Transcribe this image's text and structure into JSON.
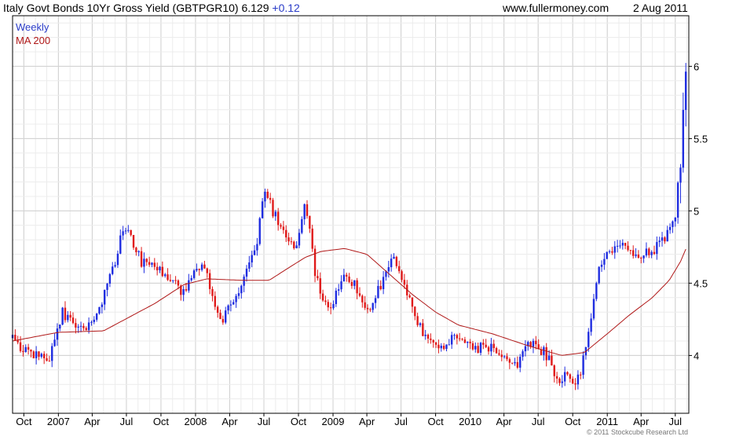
{
  "header": {
    "title": "Italy Govt Bonds 10Yr Gross Yield (GBTPGR10)",
    "last": "6.129",
    "change": "+0.12",
    "site": "www.fullermoney.com",
    "date": "2 Aug 2011"
  },
  "legend": {
    "primary": "Weekly",
    "secondary": "MA 200"
  },
  "copyright": "© 2011 Stockcube Research Ltd",
  "colors": {
    "up": "#1f2de0",
    "down": "#e01a1a",
    "ma": "#b01818",
    "grid": "#d0d0d0",
    "legend_primary": "#2a3cc8",
    "legend_secondary": "#b01818"
  },
  "chart_data": {
    "type": "candlestick",
    "frequency": "weekly",
    "x_ticks": [
      "Oct",
      "2007",
      "Apr",
      "Jul",
      "Oct",
      "2008",
      "Apr",
      "Jul",
      "Oct",
      "2009",
      "Apr",
      "Jul",
      "Oct",
      "2010",
      "Apr",
      "Jul",
      "Oct",
      "2011",
      "Apr",
      "Jul"
    ],
    "y_ticks": [
      "4",
      "4.5",
      "5",
      "5.5",
      "6"
    ],
    "ylim": [
      3.6,
      6.35
    ],
    "grid": true,
    "legend_position": "top-left",
    "price_path": [
      [
        "2006-09-01",
        4.12
      ],
      [
        "2006-10-15",
        4.0
      ],
      [
        "2006-12-10",
        4.0
      ],
      [
        "2007-01-10",
        4.3
      ],
      [
        "2007-03-15",
        4.16
      ],
      [
        "2007-05-10",
        4.45
      ],
      [
        "2007-06-25",
        4.9
      ],
      [
        "2007-08-10",
        4.65
      ],
      [
        "2007-10-15",
        4.56
      ],
      [
        "2007-11-25",
        4.45
      ],
      [
        "2008-01-20",
        4.62
      ],
      [
        "2008-03-10",
        4.25
      ],
      [
        "2008-04-25",
        4.45
      ],
      [
        "2008-06-15",
        4.8
      ],
      [
        "2008-07-01",
        5.15
      ],
      [
        "2008-08-10",
        4.9
      ],
      [
        "2008-09-20",
        4.72
      ],
      [
        "2008-10-20",
        5.05
      ],
      [
        "2008-11-15",
        4.55
      ],
      [
        "2008-12-20",
        4.3
      ],
      [
        "2009-02-01",
        4.6
      ],
      [
        "2009-04-10",
        4.3
      ],
      [
        "2009-06-10",
        4.72
      ],
      [
        "2009-07-20",
        4.4
      ],
      [
        "2009-09-01",
        4.12
      ],
      [
        "2009-10-15",
        4.05
      ],
      [
        "2009-12-01",
        4.15
      ],
      [
        "2010-01-20",
        4.05
      ],
      [
        "2010-03-10",
        4.05
      ],
      [
        "2010-05-10",
        3.95
      ],
      [
        "2010-06-15",
        4.1
      ],
      [
        "2010-07-25",
        4.0
      ],
      [
        "2010-08-30",
        3.8
      ],
      [
        "2010-09-20",
        3.9
      ],
      [
        "2010-10-10",
        3.78
      ],
      [
        "2010-11-05",
        4.05
      ],
      [
        "2010-12-10",
        4.6
      ],
      [
        "2011-01-10",
        4.72
      ],
      [
        "2011-02-15",
        4.78
      ],
      [
        "2011-03-20",
        4.7
      ],
      [
        "2011-05-01",
        4.72
      ],
      [
        "2011-06-10",
        4.85
      ],
      [
        "2011-07-01",
        4.92
      ],
      [
        "2011-07-20",
        5.6
      ],
      [
        "2011-08-02",
        6.13
      ]
    ],
    "ma_200": [
      [
        "2006-09-01",
        4.1
      ],
      [
        "2007-01-01",
        4.16
      ],
      [
        "2007-05-01",
        4.17
      ],
      [
        "2007-09-15",
        4.36
      ],
      [
        "2007-12-01",
        4.49
      ],
      [
        "2008-02-01",
        4.53
      ],
      [
        "2008-05-01",
        4.52
      ],
      [
        "2008-07-15",
        4.52
      ],
      [
        "2008-09-01",
        4.6
      ],
      [
        "2008-10-20",
        4.68
      ],
      [
        "2008-12-01",
        4.72
      ],
      [
        "2009-02-01",
        4.74
      ],
      [
        "2009-04-01",
        4.7
      ],
      [
        "2009-06-01",
        4.56
      ],
      [
        "2009-08-01",
        4.42
      ],
      [
        "2009-10-01",
        4.3
      ],
      [
        "2009-12-01",
        4.21
      ],
      [
        "2010-03-01",
        4.15
      ],
      [
        "2010-06-01",
        4.07
      ],
      [
        "2010-09-01",
        4.0
      ],
      [
        "2010-11-01",
        4.02
      ],
      [
        "2011-01-01",
        4.15
      ],
      [
        "2011-03-01",
        4.28
      ],
      [
        "2011-05-01",
        4.4
      ],
      [
        "2011-06-15",
        4.52
      ],
      [
        "2011-07-15",
        4.65
      ],
      [
        "2011-08-02",
        4.76
      ]
    ]
  }
}
